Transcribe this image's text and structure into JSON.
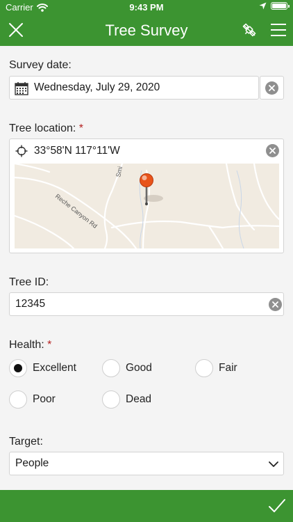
{
  "status": {
    "carrier": "Carrier",
    "time": "9:43 PM"
  },
  "header": {
    "title": "Tree Survey"
  },
  "survey_date": {
    "label": "Survey date:",
    "value": "Wednesday, July 29, 2020"
  },
  "tree_location": {
    "label": "Tree location:",
    "required_mark": "*",
    "value": "33°58'N 117°11'W",
    "map_labels": {
      "road1": "Reche Canyon Rd",
      "road2": "Smi"
    }
  },
  "tree_id": {
    "label": "Tree ID:",
    "value": "12345"
  },
  "health": {
    "label": "Health:",
    "required_mark": "*",
    "options": [
      {
        "label": "Excellent",
        "selected": true
      },
      {
        "label": "Good",
        "selected": false
      },
      {
        "label": "Fair",
        "selected": false
      },
      {
        "label": "Poor",
        "selected": false
      },
      {
        "label": "Dead",
        "selected": false
      }
    ]
  },
  "target": {
    "label": "Target:",
    "value": "People"
  },
  "colors": {
    "brand_green": "#3c9431",
    "required_red": "#b41f1f",
    "pin_orange": "#e8541b"
  },
  "icons": {
    "close": "close-icon",
    "gps": "gps-off-icon",
    "menu": "menu-icon",
    "calendar": "calendar-icon",
    "crosshair": "crosshair-icon",
    "clear": "clear-icon",
    "chevron": "chevron-down-icon",
    "submit": "checkmark-icon"
  }
}
